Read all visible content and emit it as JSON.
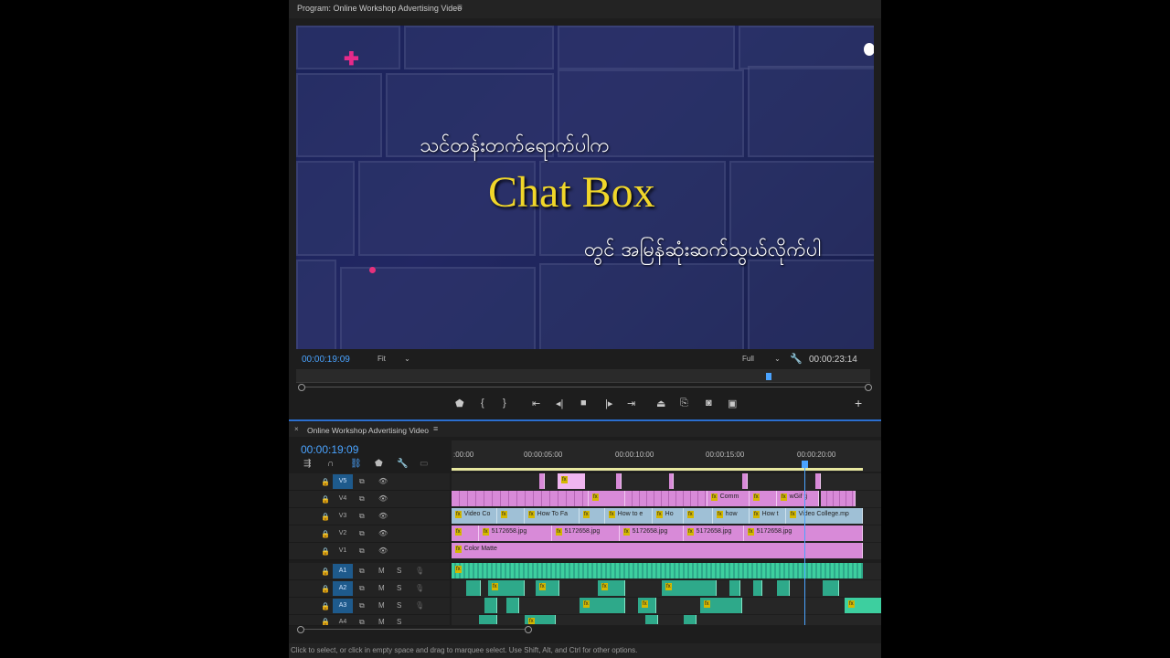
{
  "program_monitor": {
    "title": "Program: Online Workshop Advertising Video",
    "menu_icon": "hamburger-icon",
    "video": {
      "line1": "သင်တန်းတက်ရောက်ပါက",
      "headline": "Chat Box",
      "line2": "တွင် အမြန်ဆုံးဆက်သွယ်လိုက်ပါ"
    },
    "current_timecode": "00:00:19:09",
    "fit": "Fit",
    "quality": "Full",
    "duration_timecode": "00:00:23:14",
    "playhead_fraction": 0.82,
    "controls": [
      "marker-icon",
      "mark-in-icon",
      "mark-out-icon",
      "go-to-in-icon",
      "step-back-icon",
      "stop-icon",
      "play-icon",
      "step-forward-icon",
      "lift-icon",
      "extract-icon",
      "export-frame-icon",
      "compare-icon",
      "add-button-icon"
    ]
  },
  "timeline": {
    "title": "Online Workshop Advertising Video",
    "timecode": "00:00:19:09",
    "ruler_labels": [
      ":00:00",
      "00:00:05:00",
      "00:00:10:00",
      "00:00:15:00",
      "00:00:20:00"
    ],
    "tracks": [
      {
        "name": "V5",
        "active": true
      },
      {
        "name": "V4",
        "active": false
      },
      {
        "name": "V3",
        "active": false
      },
      {
        "name": "V2",
        "active": false
      },
      {
        "name": "V1",
        "active": false
      },
      {
        "name": "A1",
        "active": true
      },
      {
        "name": "A2",
        "active": true
      },
      {
        "name": "A3",
        "active": true
      },
      {
        "name": "A4",
        "active": false
      }
    ],
    "audio_buttons": {
      "mute": "M",
      "solo": "S"
    },
    "clips": {
      "v4": [
        "Comm",
        "wGif tj"
      ],
      "v3": [
        "Video Co",
        "How To Fa",
        "How to e",
        "Ho",
        "how",
        "How t",
        "Video College.mp"
      ],
      "v2": [
        "5172658.jpg",
        "5172658.jpg",
        "5172658.jpg",
        "5172658.jpg",
        "5172658.jpg"
      ],
      "v1": [
        "Color Matte"
      ]
    },
    "fx_label": "fx"
  },
  "status_bar": "Click to select, or click in empty space and drag to marquee select. Use Shift, Alt, and Ctrl for other options.",
  "colors": {
    "accent": "#4aa3ff",
    "clip_pink": "#d88ad8",
    "clip_blue": "#9fc0d6",
    "clip_audio": "#2ea98a",
    "headline_yellow": "#f0d62a"
  }
}
